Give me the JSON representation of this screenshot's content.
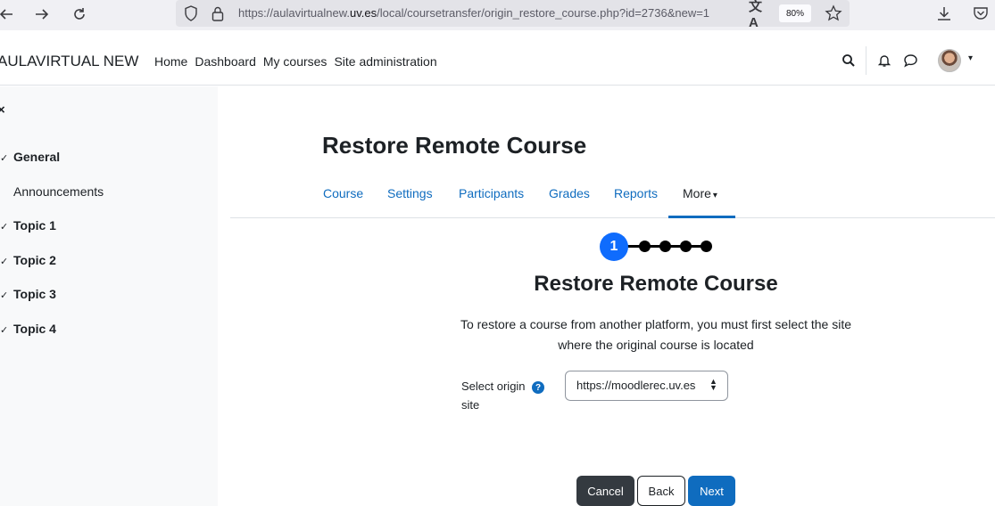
{
  "browser": {
    "url_prefix": "https://aulavirtualnew.",
    "url_domain": "uv.es",
    "url_path": "/local/coursetransfer/origin_restore_course.php?id=2736&new=1",
    "zoom": "80%",
    "icons": [
      "back-icon",
      "forward-icon",
      "reload-icon",
      "shield-icon",
      "lock-icon",
      "translate-icon",
      "star-icon",
      "download-icon",
      "pocket-icon"
    ]
  },
  "navbar": {
    "site_name": "AULAVIRTUAL NEW",
    "links": [
      "Home",
      "Dashboard",
      "My courses",
      "Site administration"
    ]
  },
  "drawer": {
    "close_glyph": "×",
    "sections": [
      {
        "label": "General"
      },
      {
        "label": "Announcements"
      },
      {
        "label": "Topic 1"
      },
      {
        "label": "Topic 2"
      },
      {
        "label": "Topic 3"
      },
      {
        "label": "Topic 4"
      }
    ]
  },
  "page": {
    "title": "Restore Remote Course",
    "tabs": [
      "Course",
      "Settings",
      "Participants",
      "Grades",
      "Reports",
      "More"
    ],
    "active_tab": "More"
  },
  "stepper": {
    "current_step": "1",
    "total_steps": 5
  },
  "form": {
    "heading": "Restore Remote Course",
    "intro": "To restore a course from another platform, you must first select the site where the original course is located",
    "origin_label": "Select origin site",
    "help_glyph": "?",
    "origin_value": "https://moodlerec.uv.es"
  },
  "buttons": {
    "cancel": "Cancel",
    "back": "Back",
    "next": "Next"
  },
  "colors": {
    "primary": "#0f6cbf",
    "step_active": "#0f6cfd",
    "cancel_bg": "#343a40",
    "drawer_bg": "#f8f9fa"
  }
}
